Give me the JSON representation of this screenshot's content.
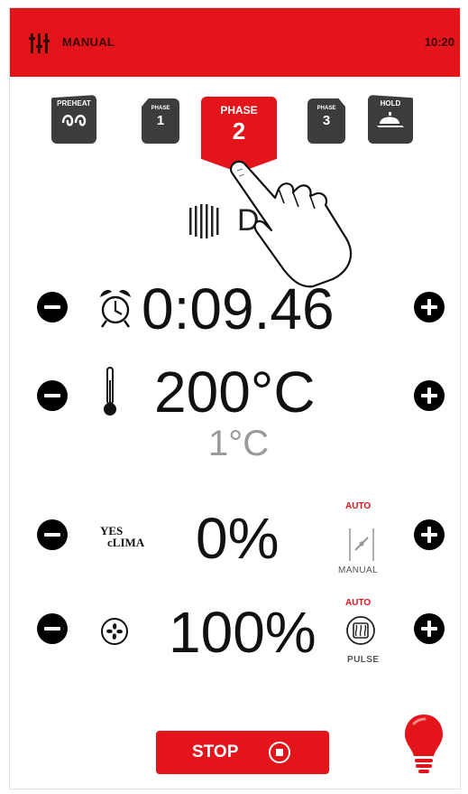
{
  "header": {
    "title": "MANUAL",
    "time": "10:20"
  },
  "phases": {
    "preheat": {
      "label": "PREHEAT"
    },
    "phase1": {
      "label": "PHASE",
      "number": "1"
    },
    "phase2": {
      "label": "PHASE",
      "number": "2"
    },
    "phase3": {
      "label": "PHASE",
      "number": "3"
    },
    "hold": {
      "label": "HOLD"
    }
  },
  "mode": {
    "text": "D"
  },
  "timer": {
    "value": "0:09.46"
  },
  "temperature": {
    "setpoint": "200°C",
    "probe": "1°C"
  },
  "humidity": {
    "logo_yes": "YES",
    "logo_clima": "cLIMA",
    "value": "0%",
    "auto_label": "AUTO",
    "manual_label": "MANUAL"
  },
  "fan": {
    "value": "100%",
    "auto_label": "AUTO",
    "pulse_label": "PULSE"
  },
  "stop": {
    "label": "STOP"
  },
  "colors": {
    "accent": "#e4141b",
    "button_dark": "#3c3c3c"
  }
}
